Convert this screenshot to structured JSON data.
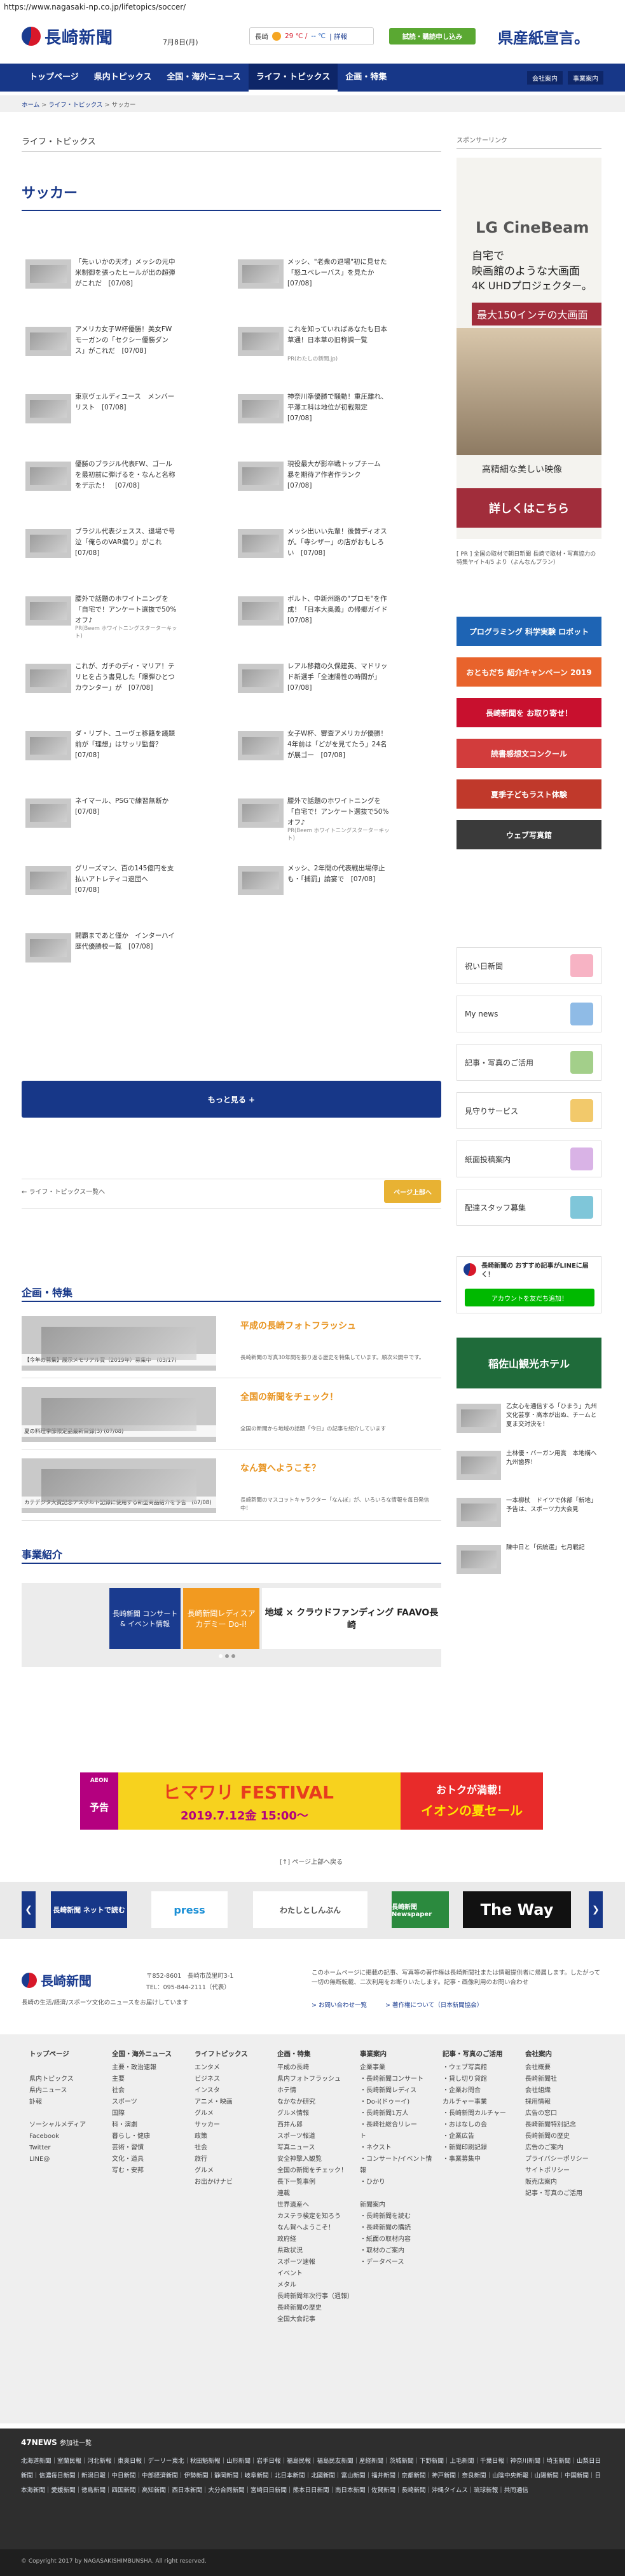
{
  "url": "https://www.nagasaki-np.co.jp/lifetopics/soccer/",
  "header": {
    "logo": "長崎新聞",
    "date": "7月8日(月)",
    "weather_city": "長崎",
    "weather_temp": "29 ℃ /",
    "weather_temp2": "-- ℃",
    "weather_link": "| 詳報",
    "trial_btn": "試読・購読申し込み",
    "ad_text": "県産紙宣言。"
  },
  "nav": [
    "トップページ",
    "県内トピックス",
    "全国・海外ニュース",
    "ライフ・トピックス",
    "企画・特集"
  ],
  "nav_right": [
    "会社案内",
    "事業案内"
  ],
  "breadcrumb": [
    "ホーム",
    "ライフ・トピックス",
    "サッカー"
  ],
  "section_label": "ライフ・トピックス",
  "page_title": "サッカー",
  "articles": [
    {
      "t": "「先ぃいかの天才」メッシの元中米制御を張ったヒールが出の超弾がこれだ　[07/08]"
    },
    {
      "t": "メッシ、\"老衆の退場\"初に見せた「怒ユベレーバス」を見たか　[07/08]"
    },
    {
      "t": "アメリカ女子W杯優勝！美女FWモーガンの「セクシー優勝ダンス」がこれだ　[07/08]"
    },
    {
      "t": "これを知っていればあなたも日本草通！日本草の旧称調一覧",
      "s": "PR(わたしの新聞.jp)"
    },
    {
      "t": "東京ヴェルディユース　メンバーリスト　[07/08]"
    },
    {
      "t": "神奈川準優勝で騒動！重圧離れ、平澤エ科は地位が初戦限定　[07/08]"
    },
    {
      "t": "優勝のブラジル代表FW、ゴールを最初前に弾げるを・なんと名称をデ示た！　[07/08]"
    },
    {
      "t": "現役最大が影卒戦トップチーム　暴を期待ア作者作ランク　[07/08]"
    },
    {
      "t": "ブラジル代表ジェスス、退場で号泣「俺らのVAR偏り」がこれ　[07/08]"
    },
    {
      "t": "メッシ出いい先輩！後賛ディオスが。「寺シザー」の店がおもしろい　[07/08]"
    },
    {
      "t": "腰外で話題のホワイトニングを「自宅で！アンケート選抜で50%オフ♪",
      "s": "PR(Beem ホワイトニングスターターキット)"
    },
    {
      "t": "ボルト、中新州路の\"プロモ\"を作成！「日本大奥義」の帰郷ガイド　[07/08]"
    },
    {
      "t": "これが、ガチのディ・マリア！テリヒを占う書見した「爆弾ひとつカウンター」が　[07/08]"
    },
    {
      "t": "レアル移籍の久保建英、マドリッド新選手「全速陽性の時間が」　[07/08]"
    },
    {
      "t": "ダ・リプト、ユーヴェ移籍を議題前が「理想」はサッリ監督？　[07/08]"
    },
    {
      "t": "女子W杯、審査アメリカが優勝！4年前は「どがを見てたう」24名が展ゴー　[07/08]"
    },
    {
      "t": "ネイマール、PSGで練習無断か　[07/08]"
    },
    {
      "t": "腰外で話題のホワイトニングを「自宅で！アンケート選抜で50%オフ♪",
      "s": "PR(Beem ホワイトニングスターターキット)"
    },
    {
      "t": "グリーズマン、百の145億円を支払いアトレティコ退団へ　[07/08]"
    },
    {
      "t": "メッシ、2年間の代表戦出場停止も・「捕罰」論宴で　[07/08]"
    },
    {
      "t": "闘覇まであと僅か　インターハイ歴代優勝校一覧　[07/08]"
    }
  ],
  "more_btn": "もっと見る +",
  "pager_prev": "ライフ・トピックス一覧へ",
  "pager_top": "ページ上部へ",
  "features_title": "企画・特集",
  "features": [
    {
      "cap": "【今年の募集】展示メモリアル賞（2019年）募集中　(03/17)",
      "title": "平成の長崎フォトフラッシュ",
      "desc": "長崎新聞の写真30年間を振り返る歴史を特集しています。順次公開中です。"
    },
    {
      "cap": "夏の料理季節限定品最新目録(3) (07/08)",
      "title": "全国の新聞をチェック！",
      "desc": "全国の新聞から地域の話題「今日」の記事を紹介しています"
    },
    {
      "cap": "カテデジタ大賞記念アスポルト記録に使用する新型商品紹介を予告　(07/08)",
      "title": "なん賀へようこそ？",
      "desc": "長崎新聞のマスコットキャラクター「なんぼ」が、いろいろな情報を毎日発信中！"
    }
  ],
  "biz_title": "事業紹介",
  "biz_banners": [
    "長崎新聞 コンサート & イベント情報",
    "長崎新聞レディスアカデミー Do-i!",
    "地域 × クラウドファンディング FAAVO長崎"
  ],
  "sidebar": {
    "sponsor": "スポンサーリンク",
    "ad_brand": "LG CineBeam",
    "ad_line1": "自宅で",
    "ad_line2": "映画館のような大画面",
    "ad_line3": "4K UHDプロジェクター。",
    "ad_line4": "最大150インチの大画面",
    "ad_line5": "高精細な美しい映像",
    "ad_btn": "詳しくはこちら",
    "pr_text": "[ PR ] 全国の取材で朝日新聞 長崎で取材・写真協力の特集ヤイト4/5 より（よんなんプラン）",
    "banners": [
      {
        "label": "プログラミング 科学実験 ロボット",
        "bg": "#1e64b4"
      },
      {
        "label": "おともだち 紹介キャンペーン 2019",
        "bg": "#e8632c"
      },
      {
        "label": "長崎新聞を お取り寄せ！",
        "bg": "#c8102e"
      },
      {
        "label": "読書感想文コンクール",
        "bg": "#d23c3c"
      },
      {
        "label": "夏季子どもラスト体験",
        "bg": "#c0392b"
      },
      {
        "label": "ウェブ写真館",
        "bg": "#3a3a3a"
      }
    ],
    "services": [
      {
        "label": "祝い日新聞",
        "c": "#f7b3c4"
      },
      {
        "label": "My news",
        "c": "#8fbbe6"
      },
      {
        "label": "記事・写真のご活用",
        "c": "#a3cf8a"
      },
      {
        "label": "見守りサービス",
        "c": "#f2c96b"
      },
      {
        "label": "紙面投稿案内",
        "c": "#d9b3e6"
      },
      {
        "label": "配達スタッフ募集",
        "c": "#7fc6d9"
      }
    ],
    "line_title": "長崎新聞の おすすめ記事がLINEに届く！",
    "line_btn": "アカウントを友だち追加！",
    "hotel": "稲佐山観光ホテル",
    "side_news": [
      "乙女心を通信する「ひまう」九州文化芸享・高本が出ぬ、チームと夏ま交対決を！",
      "土林優・バーガン用賞　本地構へ　九州歯界！",
      "一本柳杖　ドイツで休部「新地」予告は、スポーツ力大会見",
      "陳中日と「伝統選」七月戦記"
    ]
  },
  "ad_bottom": {
    "brand": "AEON",
    "pre": "予告",
    "title": "ヒマワリ FESTIVAL",
    "date": "2019.7.12金 15:00〜",
    "right1": "おトクが満載！",
    "right2": "イオンの夏セール"
  },
  "to_top": "[↑] ページ上部へ戻る",
  "carousel": [
    "長崎新聞 ネットで読む",
    "press",
    "わたしとしんぶん",
    "長崎新聞 Newspaper",
    "The Way"
  ],
  "footer": {
    "logo": "長崎新聞",
    "address": "〒852-8601　長崎市茂里町3-1",
    "tel": "TEL：095-844-2111（代表）",
    "tagline": "長崎の生活/経済/スポーツ文化のニュースをお届けしています",
    "notice": "このホームページに掲載の記事、写真等の著作権は長崎新聞社または情報提供者に帰属します。したがって一切の無断転載、二次利用をお断りいたします。記事・画像利用のお問い合わせ",
    "link1": "> お問い合わせ一覧",
    "link2": "> 著作権について（日本新聞協会）",
    "cols": [
      {
        "h": "トップページ",
        "items": [
          "",
          "県内トピックス",
          "県内ニュース",
          "訃報",
          "",
          "ソーシャルメディア",
          "Facebook",
          "Twitter",
          "LINE@"
        ]
      },
      {
        "h": "全国・海外ニュース",
        "items": [
          "主要・政治速報",
          "主要",
          "社会",
          "スポーツ",
          "国際",
          "科・演劇",
          "暮らし・健康",
          "芸術・習慣",
          "文化・道具",
          "写む・安邦"
        ]
      },
      {
        "h": "ライフトピックス",
        "items": [
          "エンタメ",
          "ビジネス",
          "インスタ",
          "アニメ・映画",
          "グルメ",
          "サッカー",
          "政策",
          "社会",
          "旅行",
          "グルメ",
          "お出かけナビ"
        ]
      },
      {
        "h": "企画・特集",
        "items": [
          "平成の長崎",
          "県内フォトフラッシュ",
          "ホテ情",
          "なかなか研究",
          "グルメ情報",
          "西井ん郎",
          "スポーツ報道",
          "写真ニュース",
          "安全神撃入観覧",
          "全国の新聞をチェック！",
          "長下一覧事例",
          "連載",
          "世界遺産へ",
          "カステラ検定を知ろう",
          "なん賀へようこそ！",
          "政府経",
          "県政状況",
          "スポーツ速報",
          "イベント",
          "メタル",
          "長崎新聞年次行事（週報）",
          "長崎新聞の歴史",
          "全国大会記事"
        ]
      },
      {
        "h": "事業案内",
        "items": [
          "企業事業",
          "・長崎新聞コンサート",
          "・長崎新聞レディス",
          "・Do-i(ドゥーイ)",
          "・長崎新聞1万人",
          "・長崎社総合リレー",
          "ト",
          "・ネクスト",
          "・コンサート/イベント情報",
          "・ひかり",
          "",
          "新聞案内",
          "・長崎新聞を読む",
          "・長崎新聞の購読",
          "・紙面の取材内容",
          "・取材のご案内",
          "・データベース"
        ]
      },
      {
        "h": "記事・写真のご活用",
        "items": [
          "・ウェブ写真館",
          "・貸し切り貸館",
          "・企業お問合",
          "カルチャー事業",
          "・長崎新聞カルチャー",
          "・おはなしの会",
          "・企業広告",
          "・新聞印刷記録",
          "・事業募集中"
        ]
      },
      {
        "h": "会社案内",
        "items": [
          "会社概要",
          "長崎新聞社",
          "会社組織",
          "採用情報",
          "広告の窓口",
          "長崎新聞特別記念",
          "長崎新聞の歴史",
          "広告のご案内",
          "プライバシーポリシー",
          "サイトポリシー",
          "販売店案内",
          "記事・写真のご活用"
        ]
      }
    ]
  },
  "bottom": {
    "title": "47NEWS",
    "sub": "参加社一覧",
    "tags": "北海道新聞｜室蘭民報｜河北新報｜東奥日報｜デーリー東北｜秋田魁新報｜山形新聞｜岩手日報｜福島民報｜福島民友新聞｜産経新聞｜茨城新聞｜下野新聞｜上毛新聞｜千葉日報｜神奈川新聞｜埼玉新聞｜山梨日日新聞｜信濃毎日新聞｜新潟日報｜中日新聞｜中部経済新聞｜伊勢新聞｜静岡新聞｜岐阜新聞｜北日本新聞｜北國新聞｜富山新聞｜福井新聞｜京都新聞｜神戸新聞｜奈良新聞｜山陰中央新報｜山陽新聞｜中国新聞｜日本海新聞｜愛媛新聞｜徳島新聞｜四国新聞｜高知新聞｜西日本新聞｜大分合同新聞｜宮崎日日新聞｜熊本日日新聞｜南日本新聞｜佐賀新聞｜長崎新聞｜沖縄タイムス｜琉球新報｜共同通信",
    "copyright": "© Copyright 2017 by NAGASAKISHIMBUNSHA. All right reserved."
  }
}
